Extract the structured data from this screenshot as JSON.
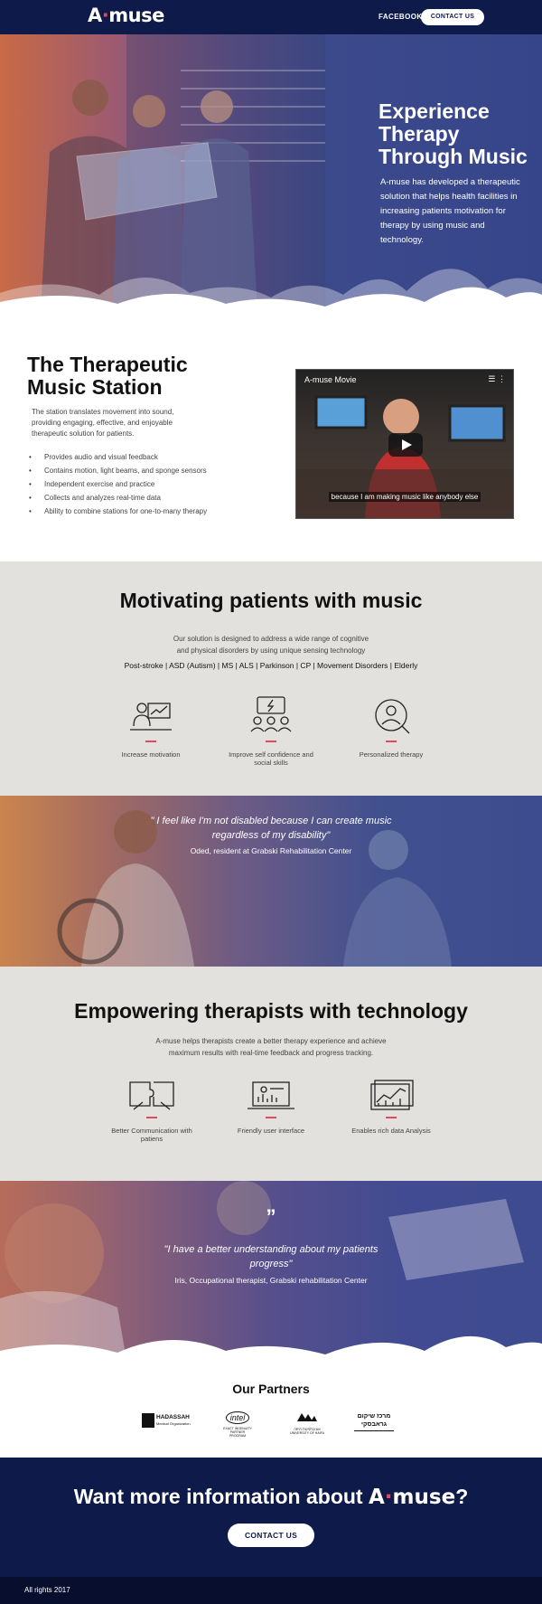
{
  "header": {
    "logo": "A·muse",
    "logo_prefix": "A",
    "logo_dot": "·",
    "logo_suffix": "muse",
    "nav_facebook": "FACEBOOK",
    "nav_contact": "CONTACT US"
  },
  "hero": {
    "title": "Experience Therapy Through Music",
    "text": "A-muse has developed a therapeutic solution that helps health facilities in increasing patients motivation for therapy by using music and technology."
  },
  "station": {
    "title": "The Therapeutic Music Station",
    "description": "The station translates movement into sound, providing engaging, effective, and enjoyable therapeutic solution for patients.",
    "features": [
      "Provides audio and visual feedback",
      "Contains motion, light beams, and sponge sensors",
      "Independent exercise and practice",
      "Collects and analyzes real-time data",
      "Ability to combine stations for one-to-many therapy"
    ],
    "video": {
      "title": "A-muse Movie",
      "caption": "because I am making music like anybody else"
    }
  },
  "motivating": {
    "title": "Motivating patients with music",
    "description": "Our solution is designed to address a wide range of cognitive and physical disorders by using unique sensing technology",
    "conditions": "Post-stroke | ASD (Autism) | MS | ALS | Parkinson | CP | Movement Disorders | Elderly",
    "features": [
      {
        "icon": "presentation-chart-icon",
        "label": "Increase motivation"
      },
      {
        "icon": "group-discussion-icon",
        "label": "Improve self confidence and social skills"
      },
      {
        "icon": "user-search-icon",
        "label": "Personalized therapy"
      }
    ]
  },
  "quote1": {
    "text": "\" I feel like I'm not disabled because I can create music regardless of my disability\"",
    "author": "Oded, resident at Grabski Rehabilitation Center"
  },
  "therapists": {
    "title": "Empowering therapists with technology",
    "description": "A-muse helps therapists create a better therapy experience and achieve maximum results with real-time feedback and progress tracking.",
    "features": [
      {
        "icon": "puzzle-hands-icon",
        "label": "Better Communication with patiens"
      },
      {
        "icon": "laptop-dashboard-icon",
        "label": "Friendly user interface"
      },
      {
        "icon": "data-chart-icon",
        "label": "Enables rich data Analysis"
      }
    ]
  },
  "quote2": {
    "mark": "”",
    "text": "\"I have a better understanding about my patients progress\"",
    "author": "Iris, Occupational therapist, Grabski rehabilitation Center"
  },
  "partners": {
    "title": "Our Partners",
    "logos": [
      {
        "name": "HADASSAH",
        "sub": "Medical Organization"
      },
      {
        "name": "intel",
        "sub": "EXACT INGENUITY PARTNER PROGRAM"
      },
      {
        "name": "אוניברסיטת חיפה",
        "sub": "UNIVERSITY OF HAIFA"
      },
      {
        "name": "מרכז שיקום גראבסקי",
        "sub": ""
      }
    ]
  },
  "cta": {
    "title_prefix": "Want more information about",
    "brand_prefix": "A",
    "brand_dot": "·",
    "brand_suffix": "muse",
    "title_suffix": "?",
    "button": "CONTACT US"
  },
  "footer": {
    "text": "All rights 2017"
  },
  "colors": {
    "navy": "#0d1a4a",
    "accent": "#e8465a",
    "light_gray": "#e2e1de"
  }
}
